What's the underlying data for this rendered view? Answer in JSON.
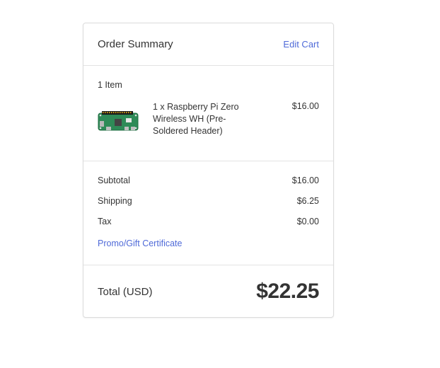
{
  "summary": {
    "title": "Order Summary",
    "edit_link": "Edit Cart",
    "item_count": "1 Item",
    "items": [
      {
        "name": "1 x Raspberry Pi Zero Wireless WH (Pre-Soldered Header)",
        "price": "$16.00",
        "image": "raspberry-pi-zero-board-icon"
      }
    ],
    "subtotal_label": "Subtotal",
    "subtotal_value": "$16.00",
    "shipping_label": "Shipping",
    "shipping_value": "$6.25",
    "tax_label": "Tax",
    "tax_value": "$0.00",
    "promo_link": "Promo/Gift Certificate",
    "total_label": "Total (USD)",
    "total_value": "$22.25"
  },
  "colors": {
    "link": "#4f6ad8",
    "text": "#333333",
    "border": "#dcdcdc"
  }
}
